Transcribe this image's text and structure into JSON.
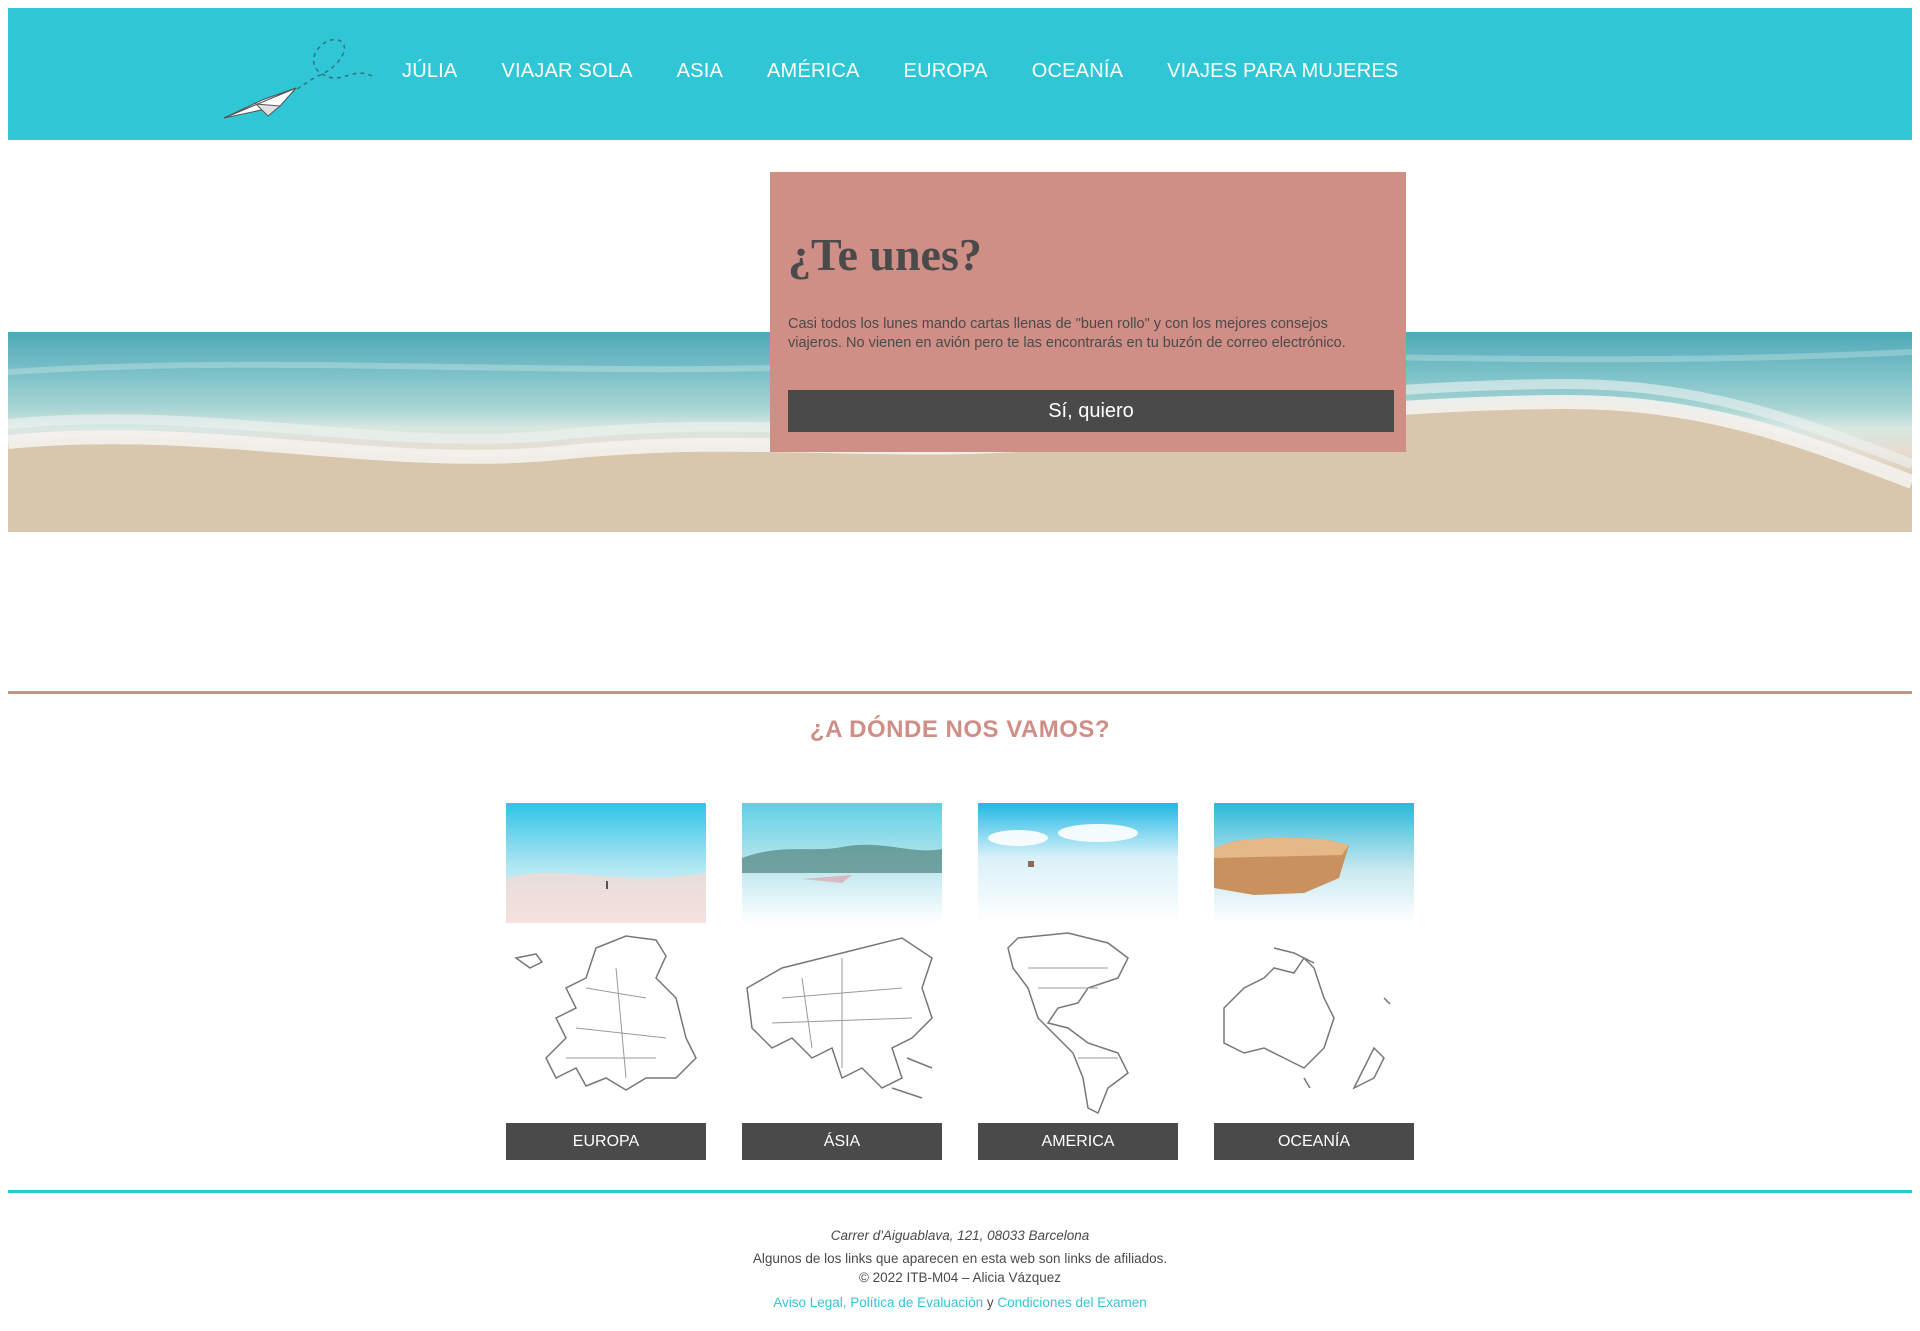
{
  "header": {
    "nav": [
      "JÚLIA",
      "VIAJAR SOLA",
      "ASIA",
      "AMÉRICA",
      "EUROPA",
      "OCEANÍA",
      "VIAJES PARA MUJERES"
    ]
  },
  "signup": {
    "title": "¿Te unes?",
    "text": "Casi todos los lunes mando cartas llenas de \"buen rollo\" y con los mejores consejos viajeros. No vienen en avión pero te las encontrarás en tu buzón de correo electrónico.",
    "button": "Sí, quiero"
  },
  "destinations": {
    "title": "¿A DÓNDE NOS VAMOS?",
    "cards": [
      {
        "label": "EUROPA",
        "icon": "europe-map-icon"
      },
      {
        "label": "ÁSIA",
        "icon": "asia-map-icon"
      },
      {
        "label": "AMERICA",
        "icon": "america-map-icon"
      },
      {
        "label": "OCEANÍA",
        "icon": "oceania-map-icon"
      }
    ]
  },
  "footer": {
    "address": "Carrer d'Aiguablava, 121, 08033 Barcelona",
    "affiliates": "Algunos de los links que aparecen en esta web son links de afiliados.",
    "copyright": "© 2022 ITB-M04 – Alicia Vázquez",
    "link1": "Aviso Legal, Política de Evaluación",
    "connector": "y",
    "link2": "Condiciones del Examen"
  },
  "colors": {
    "brand_cyan": "#2fc7d6",
    "accent_pink": "#cf8f87",
    "dark": "#4a4a4a"
  }
}
